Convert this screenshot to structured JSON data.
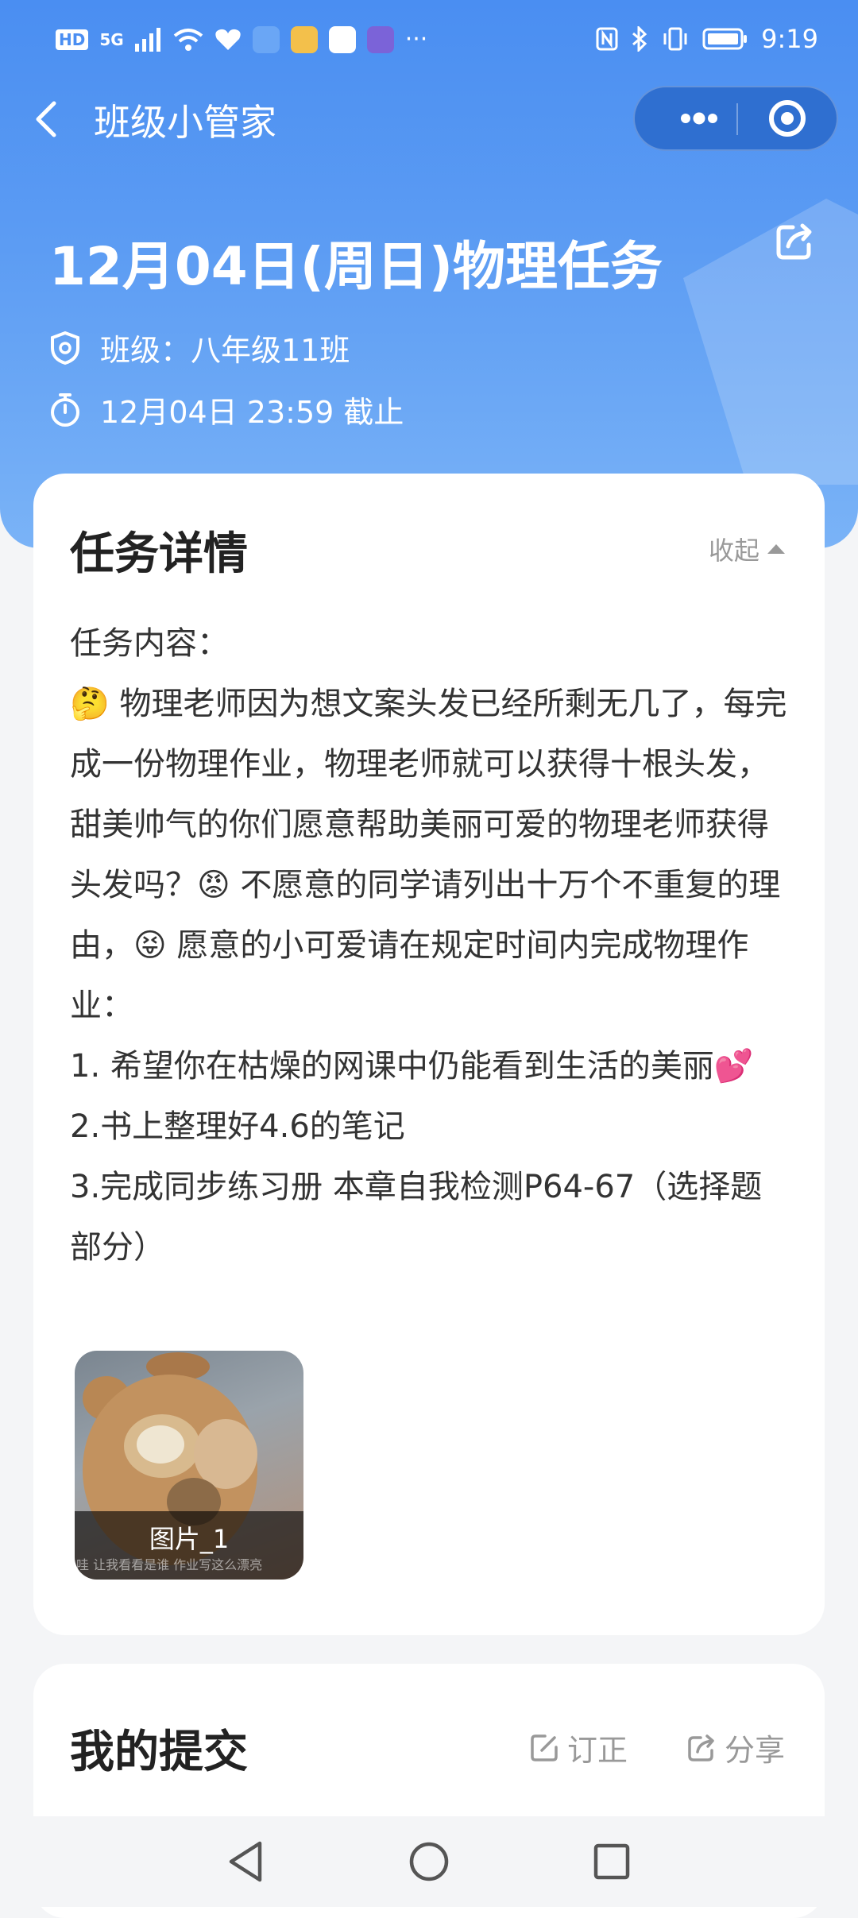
{
  "status_bar": {
    "hd": "HD",
    "network": "5G",
    "more": "···",
    "time": "9:19",
    "app_icons": [
      "cloud-icon",
      "weibo-icon",
      "sina-icon",
      "graduation-icon"
    ]
  },
  "nav": {
    "title": "班级小管家"
  },
  "task": {
    "title": "12月04日(周日)物理任务",
    "class_line": "班级：八年级11班",
    "deadline_line": "12月04日 23:59 截止"
  },
  "details": {
    "heading": "任务详情",
    "collapse_label": "收起",
    "content": "任务内容：\n🤔 物理老师因为想文案头发已经所剩无几了，每完成一份物理作业，物理老师就可以获得十根头发，甜美帅气的你们愿意帮助美丽可爱的物理老师获得头发吗？😡 不愿意的同学请列出十万个不重复的理由，😝 愿意的小可爱请在规定时间内完成物理作业：\n1. 希望你在枯燥的网课中仍能看到生活的美丽💕\n2.书上整理好4.6的笔记\n3.完成同步练习册 本章自我检测P64-67（选择题部分）",
    "image_caption": "图片_1",
    "image_subtitle": "哇 让我看看是谁 作业写这么漂亮"
  },
  "submission": {
    "heading": "我的提交",
    "correct_label": "订正",
    "share_label": "分享"
  },
  "colors": {
    "header_blue": "#4a8ef2",
    "capsule_blue": "#2f6fd0",
    "text_dark": "#222222",
    "text_muted": "#999999"
  }
}
